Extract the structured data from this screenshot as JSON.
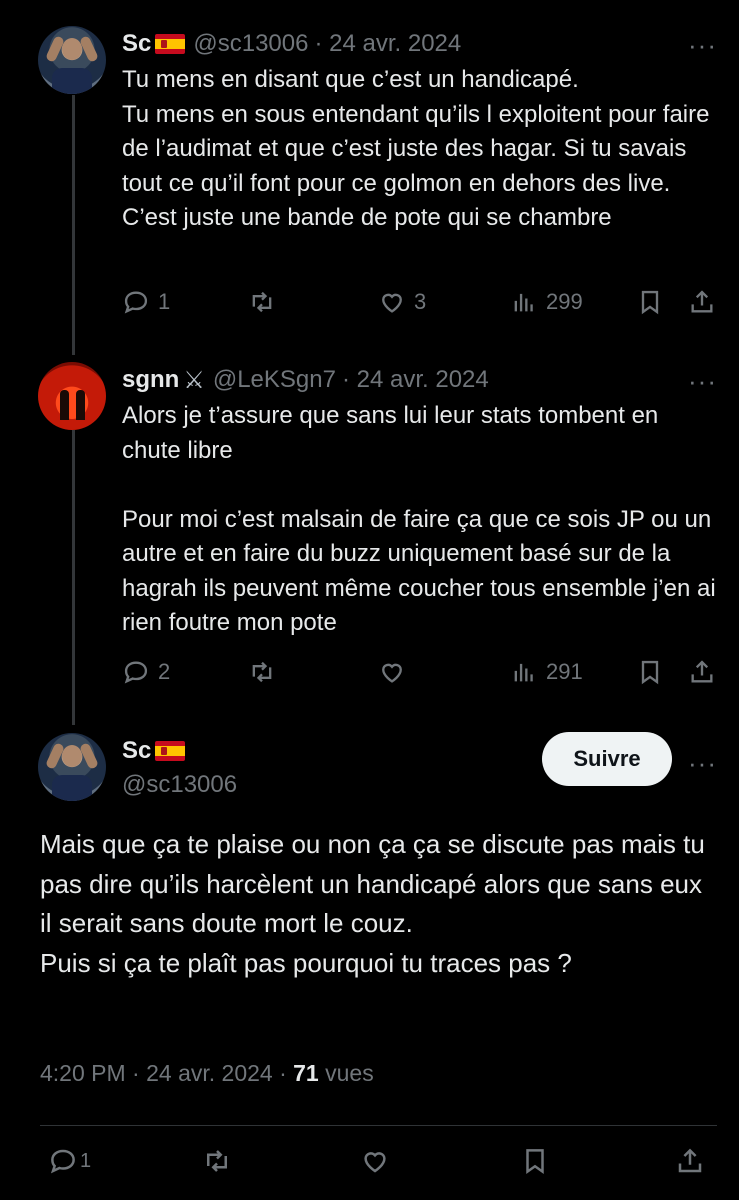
{
  "tweets": [
    {
      "name": "Sc",
      "handle": "@sc13006",
      "date": "· 24 avr. 2024",
      "text": "Tu mens en disant que c’est un handicapé.\nTu mens en sous entendant qu’ils l exploitent pour faire de l’audimat et que c’est juste des hagar. Si tu savais tout ce qu’il font pour ce golmon en dehors des live. C’est juste une bande de pote qui se chambre",
      "replies": "1",
      "retweets": "",
      "likes": "3",
      "views": "299",
      "more": "···"
    },
    {
      "name": "sgnn",
      "handle": "@LeKSgn7",
      "date": "· 24 avr. 2024",
      "text": "Alors je t’assure que sans lui leur stats tombent en chute libre\n\nPour moi c’est malsain de faire ça que ce sois JP ou un autre et en faire du buzz uniquement basé sur de la hagrah ils peuvent même coucher tous ensemble j’en ai rien foutre mon pote",
      "replies": "2",
      "retweets": "",
      "likes": "",
      "views": "291",
      "more": "···"
    }
  ],
  "main_tweet": {
    "name": "Sc",
    "handle": "@sc13006",
    "follow_label": "Suivre",
    "more": "···",
    "text": "Mais que ça te plaise ou non ça ça se discute pas mais tu pas dire qu’ils harcèlent un handicapé alors que sans eux il serait sans doute mort le couz.\nPuis si ça te plaît pas pourquoi tu traces pas ?",
    "time": "4:20 PM",
    "date": "· 24 avr. 2024 ·",
    "views_count": "71",
    "views_label": "vues",
    "replies": "1"
  },
  "icons": [
    "reply-icon",
    "retweet-icon",
    "like-icon",
    "views-icon",
    "bookmark-icon",
    "share-icon",
    "more-icon",
    "spain-flag-icon",
    "crossed-swords-icon"
  ],
  "colors": {
    "background": "#000000",
    "text": "#e7e9ea",
    "muted": "#71767b",
    "button_bg": "#eff3f4"
  }
}
